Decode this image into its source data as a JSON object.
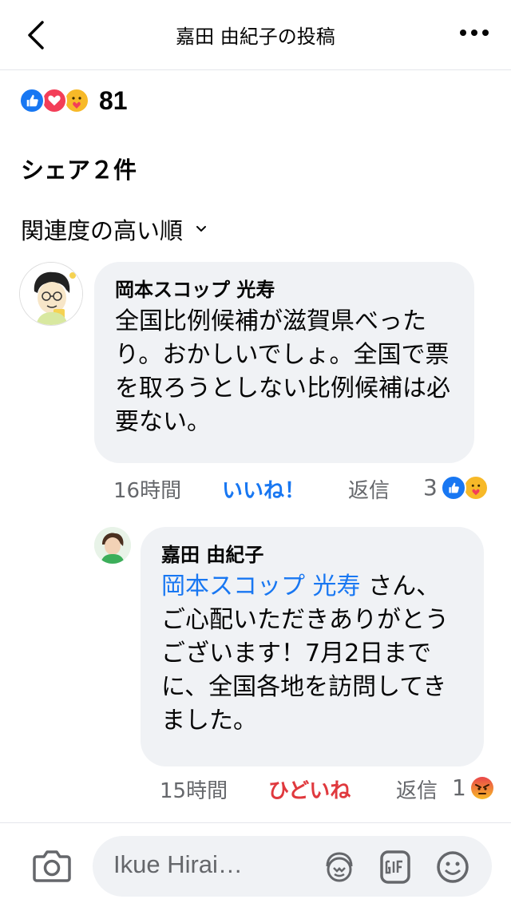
{
  "header": {
    "title": "嘉田 由紀子の投稿"
  },
  "reactions": {
    "count": "81",
    "icons": [
      "like-icon",
      "love-icon",
      "care-icon"
    ]
  },
  "share_text": "シェア２件",
  "sort_label": "関連度の高い順",
  "comments": [
    {
      "author": "岡本スコップ 光寿",
      "text": "全国比例候補が滋賀県べったり。おかしいでしょ。全国で票を取ろうとしない比例候補は必要ない。",
      "time": "16時間",
      "like_label": "いいね！",
      "reply_label": "返信",
      "reaction_count": "3"
    },
    {
      "author": "嘉田 由紀子",
      "mention": "岡本スコップ 光寿",
      "text": " さん、ご心配いただきありがとうございます！7月2日までに、全国各地を訪問してきました。",
      "time": "15時間",
      "like_label": "ひどいね",
      "reply_label": "返信",
      "reaction_count": "1"
    }
  ],
  "composer": {
    "placeholder": "Ikue Hirai…"
  },
  "colors": {
    "accent": "#1877f2",
    "angry": "#e0393e",
    "bubble": "#f0f2f5",
    "muted": "#65676b"
  }
}
